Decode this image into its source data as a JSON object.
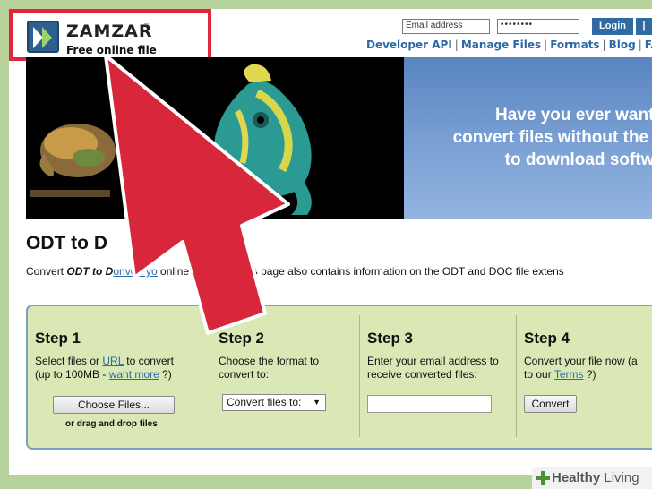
{
  "header": {
    "logo_name": "ZAMZAR",
    "logo_tm": "™",
    "logo_tagline": "Free online file conversion",
    "email_placeholder": "Email address",
    "password_mask": "••••••••",
    "login_label": "Login",
    "login_extra": "|"
  },
  "nav": {
    "items": [
      "Developer API",
      "Manage Files",
      "Formats",
      "Blog",
      "FAQ"
    ]
  },
  "banner": {
    "text": "Have you ever wante\nconvert files without the n\nto download softwa"
  },
  "main": {
    "title": "ODT to D",
    "desc_before": "Convert ",
    "desc_bold": "ODT to D",
    "desc_link": "onvert yo",
    "desc_after": " online and free - this page also contains information on the ODT and DOC file extens"
  },
  "steps": {
    "step1": {
      "title": "Step 1",
      "line1_before": "Select files or ",
      "line1_link": "URL",
      "line1_after": " to convert",
      "line2_before": "(up to 100MB - ",
      "line2_link": "want more",
      "line2_after": " ?)",
      "button": "Choose Files...",
      "hint": "or drag and drop files"
    },
    "step2": {
      "title": "Step 2",
      "line1": "Choose the format to",
      "line2": "convert to:",
      "select": "Convert files to:",
      "caret": "▼"
    },
    "step3": {
      "title": "Step 3",
      "line1": "Enter your email address to",
      "line2": "receive converted files:"
    },
    "step4": {
      "title": "Step 4",
      "line1": "Convert your file now (a",
      "line2_before": "to our ",
      "line2_link": "Terms",
      "line2_after": " ?)",
      "button": "Convert"
    }
  },
  "watermark": {
    "bold": "Healthy",
    "light": " Living"
  },
  "colors": {
    "highlight_red": "#e0263a",
    "link_blue": "#2c69a6",
    "panel_green": "#d9e8b4",
    "frame_green": "#b7d29a"
  }
}
